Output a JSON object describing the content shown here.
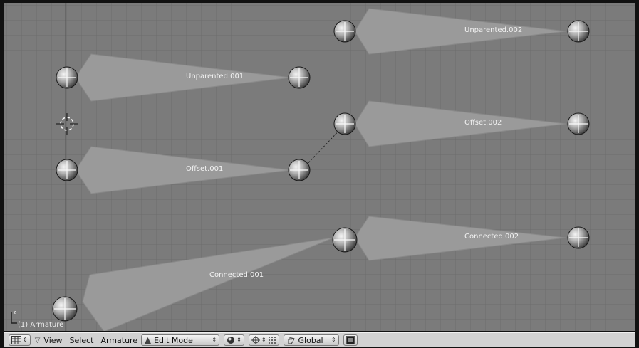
{
  "viewport": {
    "object_label": "(1) Armature",
    "axis_letter": "z",
    "bones": [
      {
        "name": "Unparented.001"
      },
      {
        "name": "Offset.001"
      },
      {
        "name": "Connected.001"
      },
      {
        "name": "Unparented.002"
      },
      {
        "name": "Offset.002"
      },
      {
        "name": "Connected.002"
      }
    ]
  },
  "toolbar": {
    "menus": [
      "View",
      "Select",
      "Armature"
    ],
    "mode": "Edit Mode",
    "orientation": "Global"
  },
  "colors": {
    "background": "#7b7b7b",
    "grid_line": "#6c6c6c",
    "bone_fill": "#9a9a9a",
    "toolbar": "#d2d2d2"
  }
}
